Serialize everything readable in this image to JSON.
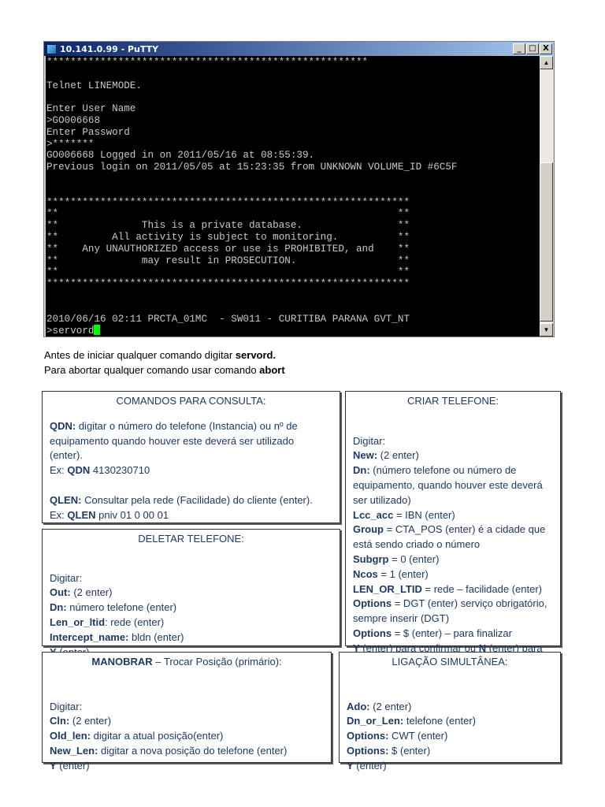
{
  "window": {
    "title": "10.141.0.99 - PuTTY",
    "minimize": "_",
    "maximize": "□",
    "close": "X"
  },
  "terminal": {
    "lines": [
      "******************************************************",
      "",
      "Telnet LINEMODE.",
      "",
      "Enter User Name",
      ">GO006668",
      "Enter Password",
      ">*******",
      "GO006668 Logged in on 2011/05/16 at 08:55:39.",
      "Previous login on 2011/05/05 at 15:23:35 from UNKNOWN VOLUME_ID #6C5F",
      "",
      "",
      "*************************************************************",
      "**                                                         **",
      "**              This is a private database.                **",
      "**         All activity is subject to monitoring.          **",
      "**    Any UNAUTHORIZED access or use is PROHIBITED, and    **",
      "**              may result in PROSECUTION.                 **",
      "**                                                         **",
      "*************************************************************",
      "",
      "",
      "2010/06/16 02:11 PRCTA_01MC  - SW011 - CURITIBA PARANA GVT_NT",
      ">servord"
    ]
  },
  "notes": [
    [
      {
        "t": "Antes de iniciar qualquer comando digitar "
      },
      {
        "t": "servord.",
        "b": true
      }
    ],
    [
      {
        "t": "Para abortar qualquer comando usar comando "
      },
      {
        "t": "abort",
        "b": true
      }
    ]
  ],
  "boxes": [
    {
      "title": [
        {
          "t": "COMANDOS PARA CONSULTA:"
        }
      ],
      "lines": [
        [
          {
            "t": "QDN:",
            "b": true
          },
          {
            "t": " digitar o número do telefone (Instancia) ou nº de"
          }
        ],
        [
          {
            "t": "equipamento quando houver este deverá ser utilizado"
          }
        ],
        [
          {
            "t": "(enter)."
          }
        ],
        [
          {
            "t": "Ex: "
          },
          {
            "t": "QDN",
            "b": true
          },
          {
            "t": " 4130230710"
          }
        ],
        [],
        [
          {
            "t": "QLEN:",
            "b": true
          },
          {
            "t": " Consultar pela rede (Facilidade) do cliente (enter)."
          }
        ],
        [
          {
            "t": "Ex: "
          },
          {
            "t": "QLEN",
            "b": true
          },
          {
            "t": " pniv 01 0 00 01"
          }
        ]
      ]
    },
    {
      "title": [
        {
          "t": "CRIAR TELEFONE:"
        }
      ],
      "lines": [
        [],
        [
          {
            "t": "Digitar:"
          }
        ],
        [
          {
            "t": "New:",
            "b": true
          },
          {
            "t": " (2 enter)"
          }
        ],
        [
          {
            "t": "Dn:",
            "b": true
          },
          {
            "t": " (número telefone ou número de"
          }
        ],
        [
          {
            "t": "equipamento, quando houver este deverá"
          }
        ],
        [
          {
            "t": "ser utilizado)"
          }
        ],
        [
          {
            "t": "Lcc_acc",
            "b": true
          },
          {
            "t": " = IBN (enter)"
          }
        ],
        [
          {
            "t": "Group",
            "b": true
          },
          {
            "t": " = CTA_POS (enter) é a cidade que"
          }
        ],
        [
          {
            "t": "está sendo criado o número"
          }
        ],
        [
          {
            "t": "Subgrp",
            "b": true
          },
          {
            "t": " = 0 (enter)"
          }
        ],
        [
          {
            "t": "Ncos",
            "b": true
          },
          {
            "t": " = 1 (enter)"
          }
        ],
        [
          {
            "t": "LEN_OR_LTID",
            "b": true
          },
          {
            "t": " = rede – facilidade (enter)"
          }
        ],
        [
          {
            "t": "Options",
            "b": true
          },
          {
            "t": " = DGT (enter) serviço obrigatório,"
          }
        ],
        [
          {
            "t": "sempre inserir (DGT)"
          }
        ],
        [
          {
            "t": "Options",
            "b": true
          },
          {
            "t": " = $ (enter) – para finalizar"
          }
        ],
        [
          {
            "t": "Y",
            "b": true
          },
          {
            "t": " (enter) para confirmar ou "
          },
          {
            "t": "N",
            "b": true
          },
          {
            "t": " (enter) para"
          }
        ]
      ]
    },
    {
      "title": [
        {
          "t": "DELETAR TELEFONE:"
        }
      ],
      "lines": [
        [],
        [
          {
            "t": "Digitar:"
          }
        ],
        [
          {
            "t": "Out:",
            "b": true
          },
          {
            "t": " (2 enter)"
          }
        ],
        [
          {
            "t": "Dn:",
            "b": true
          },
          {
            "t": " número telefone (enter)"
          }
        ],
        [
          {
            "t": "Len_or_ltid",
            "b": true
          },
          {
            "t": ": rede  (enter)"
          }
        ],
        [
          {
            "t": "Intercept_name:",
            "b": true
          },
          {
            "t": " bldn (enter)"
          }
        ],
        [
          {
            "t": "Y",
            "b": true
          },
          {
            "t": " (enter)"
          }
        ]
      ]
    },
    {
      "title": [
        {
          "t": "MANOBRAR",
          "b": true
        },
        {
          "t": " – Trocar Posição (primário):"
        }
      ],
      "lines": [
        [],
        [
          {
            "t": "Digitar:"
          }
        ],
        [
          {
            "t": "Cln:",
            "b": true
          },
          {
            "t": " (2 enter)"
          }
        ],
        [
          {
            "t": "Old_len:",
            "b": true
          },
          {
            "t": " digitar a atual posição(enter)"
          }
        ],
        [
          {
            "t": "New_Len:",
            "b": true
          },
          {
            "t": " digitar a nova posição do telefone (enter)"
          }
        ],
        [
          {
            "t": "Y",
            "b": true
          },
          {
            "t": " (enter)"
          }
        ]
      ]
    },
    {
      "title": [
        {
          "t": "LIGAÇÃO SIMULTÂNEA:"
        }
      ],
      "lines": [
        [],
        [
          {
            "t": "Ado:",
            "b": true
          },
          {
            "t": " (2 enter)"
          }
        ],
        [
          {
            "t": "Dn_or_Len:",
            "b": true
          },
          {
            "t": " telefone (enter)"
          }
        ],
        [
          {
            "t": "Options:",
            "b": true
          },
          {
            "t": " CWT (enter)"
          }
        ],
        [
          {
            "t": "Options:",
            "b": true
          },
          {
            "t": " $ (enter)"
          }
        ],
        [
          {
            "t": "Y",
            "b": true
          },
          {
            "t": " (enter)"
          }
        ]
      ]
    }
  ]
}
